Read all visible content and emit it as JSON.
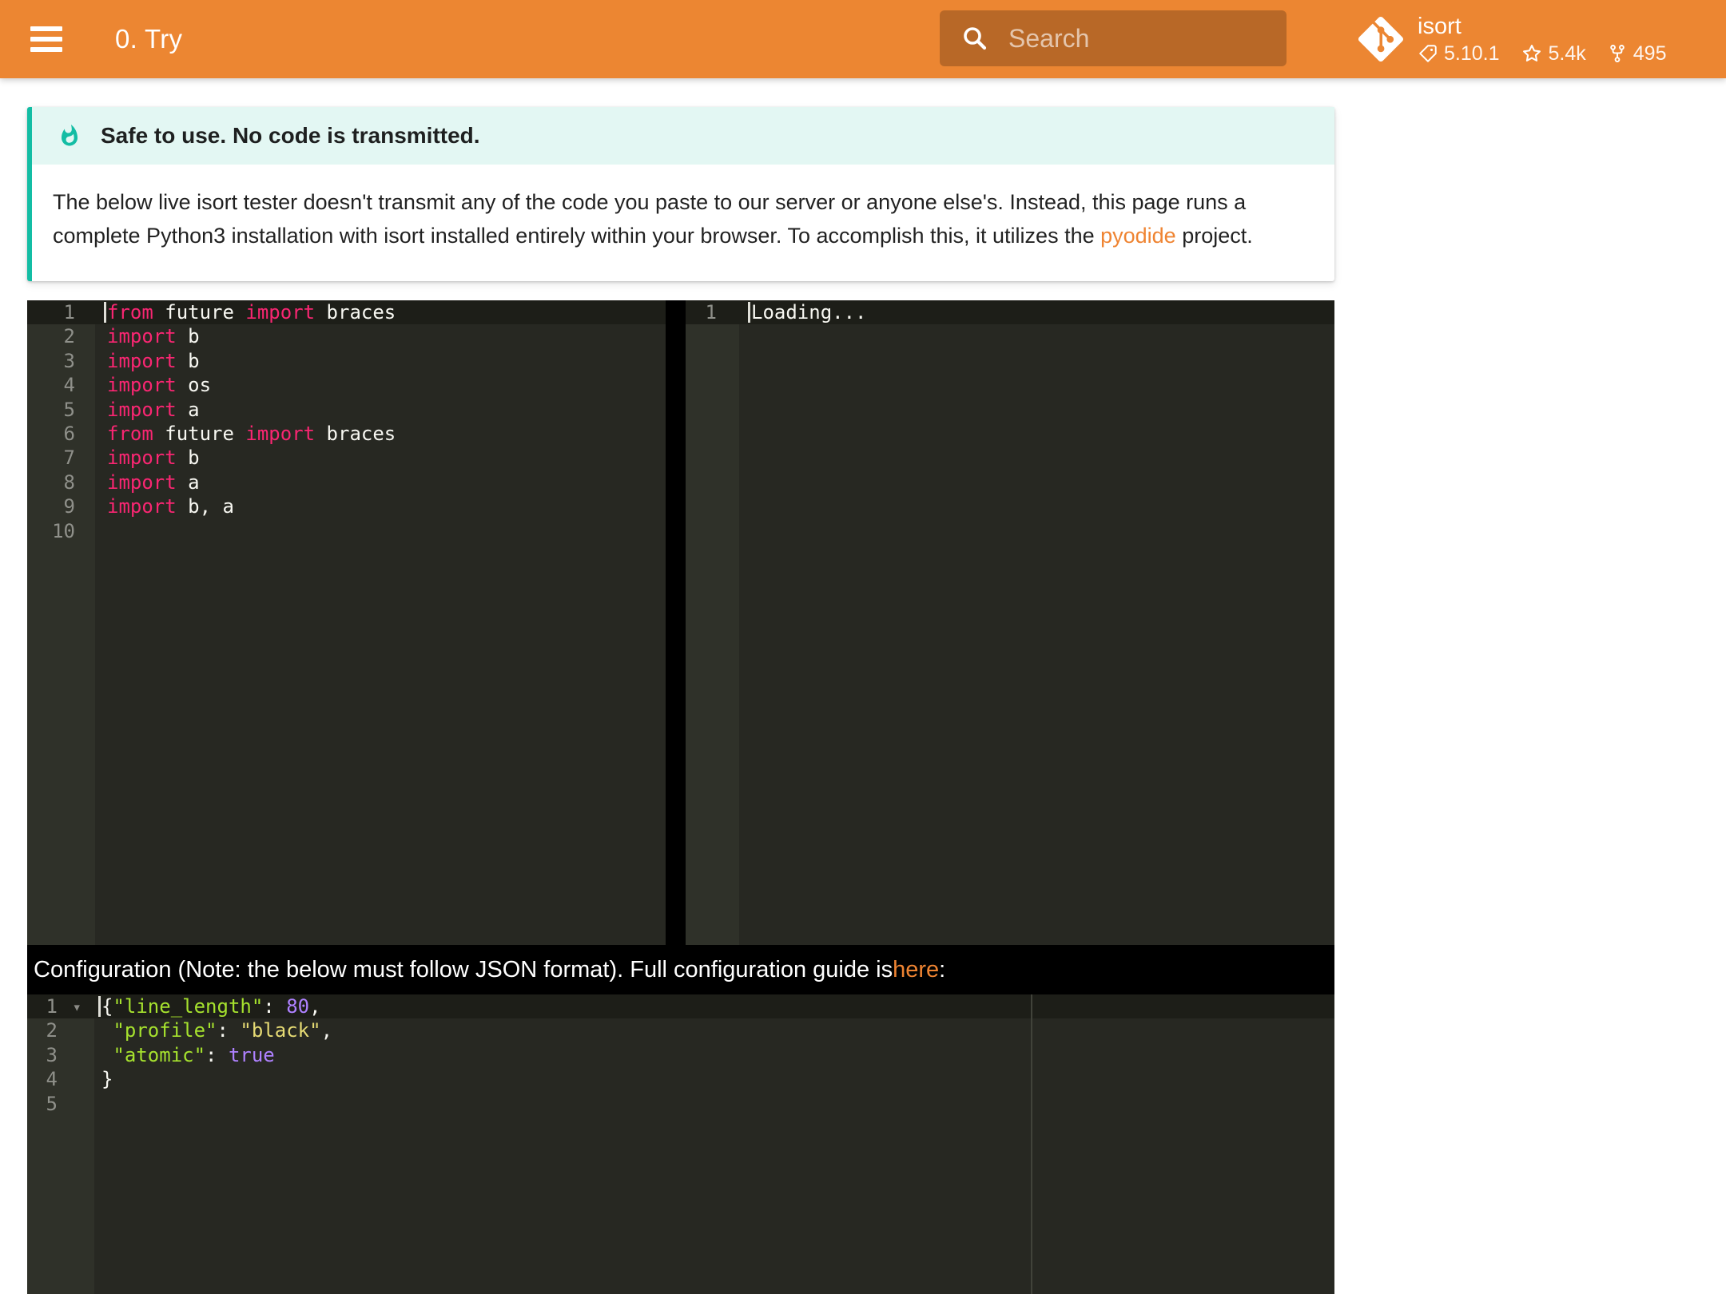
{
  "header": {
    "title": "0. Try",
    "search": {
      "placeholder": "Search"
    },
    "repo": {
      "name": "isort",
      "version": "5.10.1",
      "stars": "5.4k",
      "forks": "495"
    }
  },
  "admonition": {
    "type": "tip",
    "title": "Safe to use. No code is transmitted.",
    "body": {
      "before_link": "The below live isort tester doesn't transmit any of the code you paste to our server or anyone else's. Instead, this page runs a complete Python3 installation with isort installed entirely within your browser. To accomplish this, it utilizes the ",
      "link": "pyodide",
      "after_link": " project."
    }
  },
  "config_heading": {
    "before_link": "Configuration (Note: the below must follow JSON format). Full configuration guide is ",
    "link": "here",
    "after_link": ":"
  },
  "editors": {
    "input": {
      "language": "python",
      "line_count": 10,
      "active_line": 1,
      "cursor_line": 1,
      "lines": [
        [
          [
            "from",
            "kw"
          ],
          [
            " future ",
            "pl"
          ],
          [
            "import",
            "kw"
          ],
          [
            " braces",
            "pl"
          ]
        ],
        [
          [
            "import",
            "kw"
          ],
          [
            " b",
            "pl"
          ]
        ],
        [
          [
            "import",
            "kw"
          ],
          [
            " b",
            "pl"
          ]
        ],
        [
          [
            "import",
            "kw"
          ],
          [
            " os",
            "pl"
          ]
        ],
        [
          [
            "import",
            "kw"
          ],
          [
            " a",
            "pl"
          ]
        ],
        [
          [
            "from",
            "kw"
          ],
          [
            " future ",
            "pl"
          ],
          [
            "import",
            "kw"
          ],
          [
            " braces",
            "pl"
          ]
        ],
        [
          [
            "import",
            "kw"
          ],
          [
            " b",
            "pl"
          ]
        ],
        [
          [
            "import",
            "kw"
          ],
          [
            " a",
            "pl"
          ]
        ],
        [
          [
            "import",
            "kw"
          ],
          [
            " b, a",
            "pl"
          ]
        ],
        []
      ]
    },
    "output": {
      "language": "python",
      "line_count": 1,
      "active_line": 1,
      "cursor_line": 1,
      "lines": [
        [
          [
            "Loading...",
            "pl"
          ]
        ]
      ]
    },
    "config": {
      "language": "json",
      "line_count": 5,
      "active_line": 1,
      "cursor_line": 1,
      "fold_line": 1,
      "fold_glyph": "▾",
      "lines": [
        [
          [
            "{",
            "pl"
          ],
          [
            "\"line_length\"",
            "key"
          ],
          [
            ": ",
            "pl"
          ],
          [
            "80",
            "num"
          ],
          [
            ",",
            "pl"
          ]
        ],
        [
          [
            " ",
            "pl"
          ],
          [
            "\"profile\"",
            "key"
          ],
          [
            ": ",
            "pl"
          ],
          [
            "\"black\"",
            "str"
          ],
          [
            ",",
            "pl"
          ]
        ],
        [
          [
            " ",
            "pl"
          ],
          [
            "\"atomic\"",
            "key"
          ],
          [
            ": ",
            "pl"
          ],
          [
            "true",
            "num"
          ]
        ],
        [
          [
            "}",
            "pl"
          ]
        ],
        []
      ]
    }
  },
  "icons": {
    "menu": "hamburger-icon",
    "search": "magnifier-icon",
    "repo": "git-logo-icon",
    "version": "tag-icon",
    "stars": "star-icon",
    "forks": "fork-icon",
    "admonition": "flame-icon",
    "fold": "chevron-down-icon"
  },
  "colors": {
    "header_bg": "#EC8632",
    "accent_link": "#EF8432",
    "adm_accent": "#13BDA4",
    "adm_title_bg": "#E3F7F3",
    "editor_bg": "#272822",
    "gutter_bg": "#2F3129",
    "active_bg": "#1D1E18",
    "gutter_text": "#8F908A",
    "kw": "#F92672",
    "pl": "#F8F8F2",
    "key": "#A6E22E",
    "str": "#E6DB74",
    "num": "#AE81FF"
  }
}
